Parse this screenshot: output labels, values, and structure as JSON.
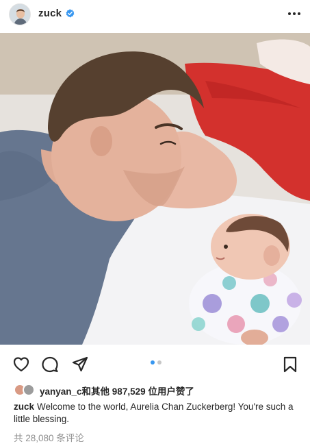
{
  "post": {
    "username": "zuck",
    "verified": true,
    "more_icon": "ellipsis-icon",
    "carousel_pages": 2,
    "carousel_current": 1
  },
  "likes": {
    "first_liker": "yanyan_c",
    "text": "和其他 987,529 位用户赞了"
  },
  "caption": {
    "username": "zuck",
    "text": "Welcome to the world, Aurelia Chan Zuckerberg! You're such a little blessing."
  },
  "comments": {
    "text": "共 28,080 条评论"
  },
  "colors": {
    "verified": "#3897f0",
    "carousel_active": "#3897f0",
    "carousel_inactive": "#c7c7c7",
    "text": "#262626",
    "muted": "#8e8e8e"
  }
}
